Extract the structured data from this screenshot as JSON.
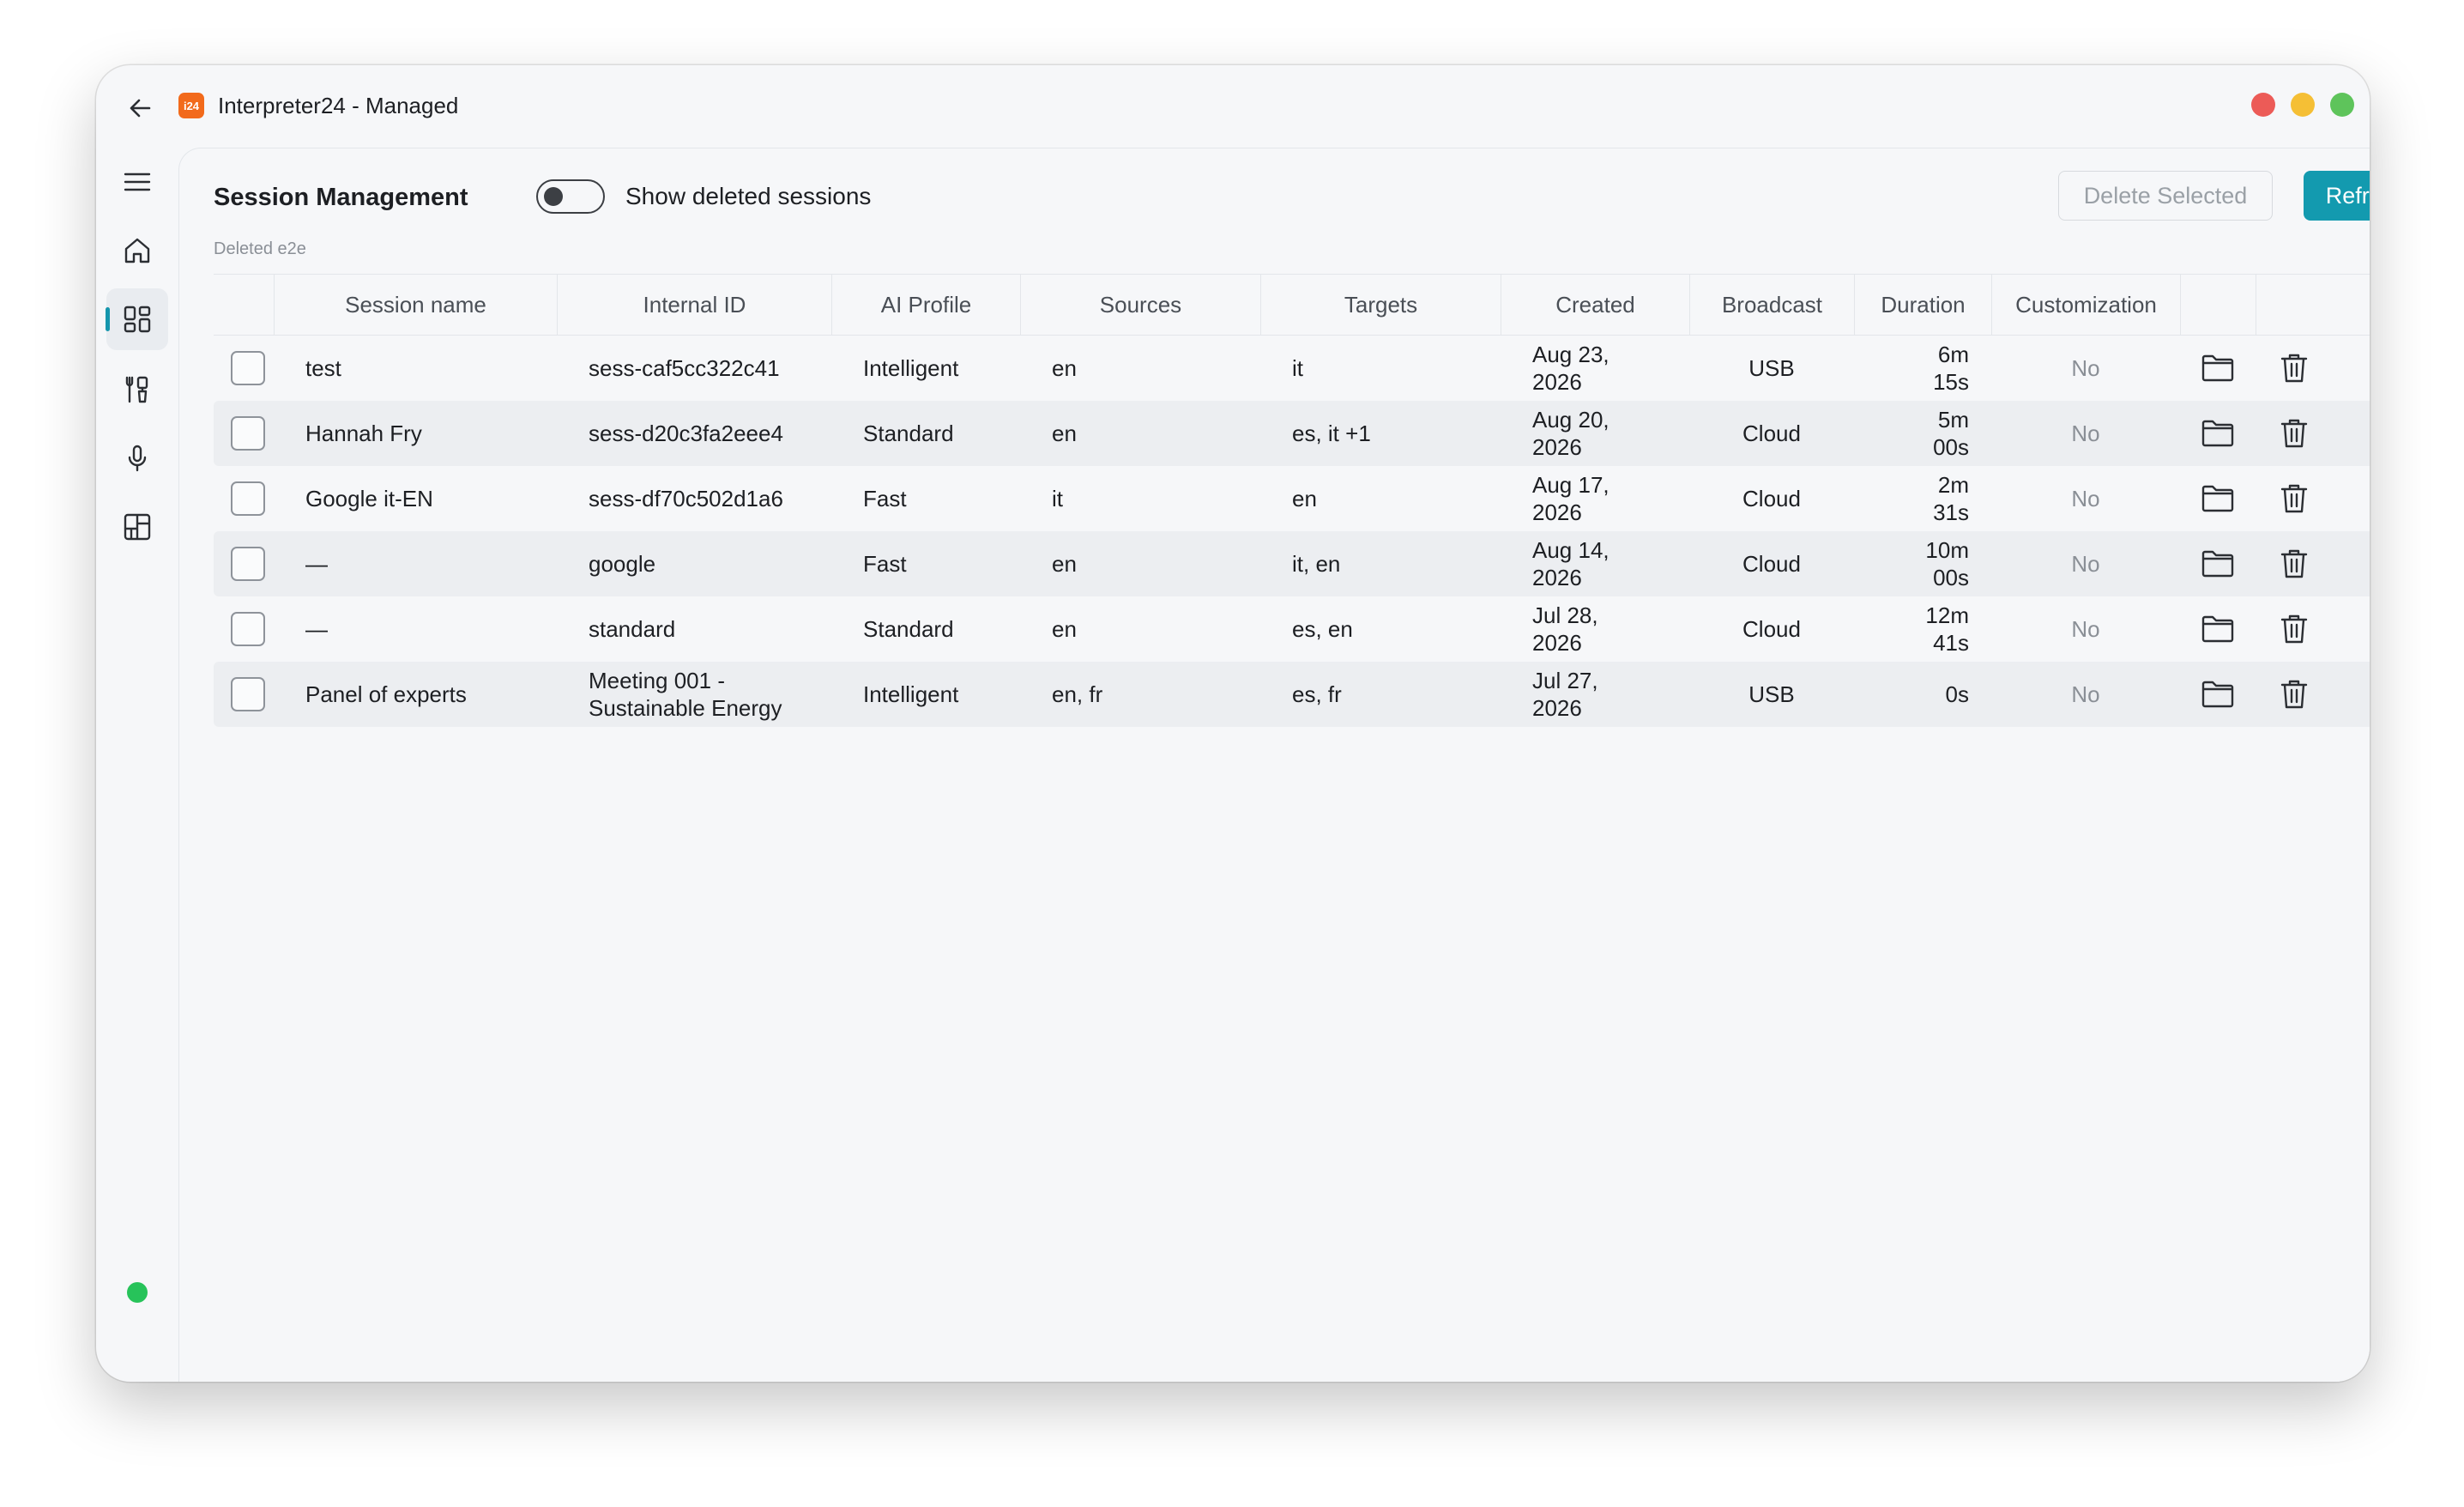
{
  "window": {
    "title": "Interpreter24 - Managed",
    "logo_text": "i24",
    "accent": "#139aaf",
    "logo_color": "#f26a1b",
    "status_color": "#27c35a"
  },
  "sidebar": {
    "items": [
      {
        "icon": "menu-icon"
      },
      {
        "icon": "home-icon"
      },
      {
        "icon": "dashboard-icon",
        "active": true
      },
      {
        "icon": "tools-icon"
      },
      {
        "icon": "microphone-icon"
      },
      {
        "icon": "layout-icon"
      }
    ],
    "footer_icon": "settings-icon"
  },
  "header": {
    "title": "Session Management",
    "toggle_label": "Show deleted sessions",
    "toggle_on": false,
    "delete_button": "Delete Selected",
    "refresh_button": "Refresh",
    "subtitle": "Deleted e2e"
  },
  "table": {
    "columns": [
      "Session name",
      "Internal ID",
      "AI Profile",
      "Sources",
      "Targets",
      "Created",
      "Broadcast",
      "Duration",
      "Customization"
    ],
    "rows": [
      {
        "name": "test",
        "id1": "sess-caf5cc322c41",
        "id2": "",
        "profile": "Intelligent",
        "sources": "en",
        "targets": "it",
        "date1": "Aug 23,",
        "date2": "2026",
        "broadcast": "USB",
        "dur1": "6m",
        "dur2": "15s",
        "custom": "No"
      },
      {
        "name": "Hannah Fry",
        "id1": "sess-d20c3fa2eee4",
        "id2": "",
        "profile": "Standard",
        "sources": "en",
        "targets": "es, it +1",
        "date1": "Aug 20,",
        "date2": "2026",
        "broadcast": "Cloud",
        "dur1": "5m",
        "dur2": "00s",
        "custom": "No"
      },
      {
        "name": "Google it-EN",
        "id1": "sess-df70c502d1a6",
        "id2": "",
        "profile": "Fast",
        "sources": "it",
        "targets": "en",
        "date1": "Aug 17,",
        "date2": "2026",
        "broadcast": "Cloud",
        "dur1": "2m",
        "dur2": "31s",
        "custom": "No"
      },
      {
        "name": "—",
        "id1": "google",
        "id2": "",
        "profile": "Fast",
        "sources": "en",
        "targets": "it, en",
        "date1": "Aug 14,",
        "date2": "2026",
        "broadcast": "Cloud",
        "dur1": "10m",
        "dur2": "00s",
        "custom": "No"
      },
      {
        "name": "—",
        "id1": "standard",
        "id2": "",
        "profile": "Standard",
        "sources": "en",
        "targets": "es, en",
        "date1": "Jul 28,",
        "date2": "2026",
        "broadcast": "Cloud",
        "dur1": "12m",
        "dur2": "41s",
        "custom": "No"
      },
      {
        "name": "Panel of experts",
        "id1": "Meeting 001 -",
        "id2": "Sustainable Energy",
        "profile": "Intelligent",
        "sources": "en, fr",
        "targets": "es, fr",
        "date1": "Jul 27,",
        "date2": "2026",
        "broadcast": "USB",
        "dur1": "0s",
        "dur2": "",
        "custom": "No"
      }
    ]
  }
}
